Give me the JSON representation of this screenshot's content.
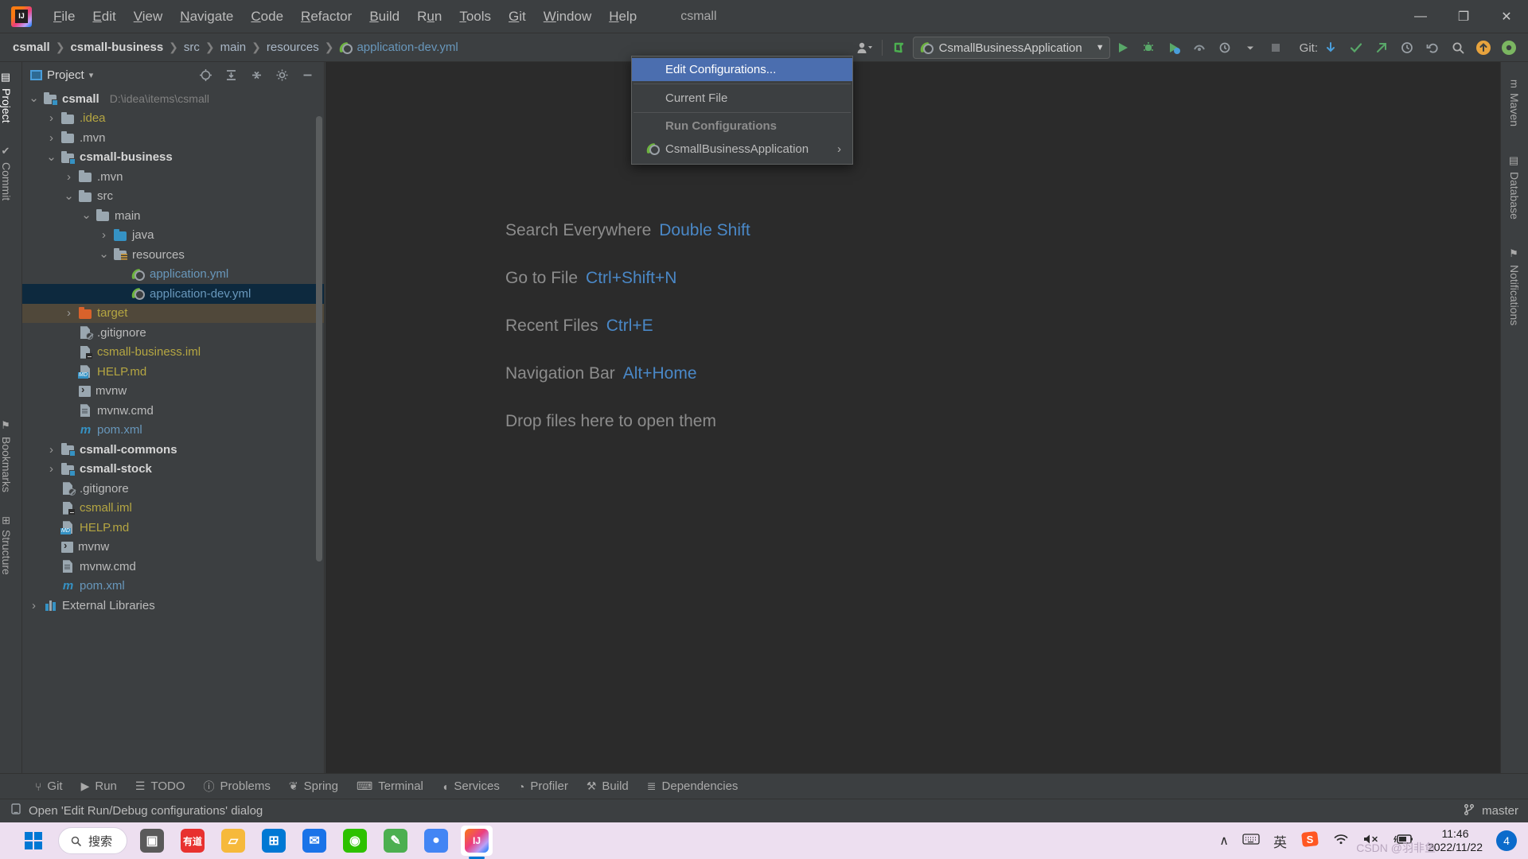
{
  "titlebar": {
    "app_icon": "intellij-idea-logo",
    "project_name": "csmall",
    "menus": [
      {
        "label": "File",
        "mnemonic": "F"
      },
      {
        "label": "Edit",
        "mnemonic": "E"
      },
      {
        "label": "View",
        "mnemonic": "V"
      },
      {
        "label": "Navigate",
        "mnemonic": "N"
      },
      {
        "label": "Code",
        "mnemonic": "C"
      },
      {
        "label": "Refactor",
        "mnemonic": "R"
      },
      {
        "label": "Build",
        "mnemonic": "B"
      },
      {
        "label": "Run",
        "mnemonic": "u"
      },
      {
        "label": "Tools",
        "mnemonic": "T"
      },
      {
        "label": "Git",
        "mnemonic": "G"
      },
      {
        "label": "Window",
        "mnemonic": "W"
      },
      {
        "label": "Help",
        "mnemonic": "H"
      }
    ],
    "window_controls": {
      "minimize": "—",
      "maximize": "❐",
      "close": "✕"
    }
  },
  "navbar": {
    "breadcrumbs": [
      {
        "label": "csmall",
        "style": "bold"
      },
      {
        "label": "csmall-business",
        "style": "bold"
      },
      {
        "label": "src",
        "style": "plain"
      },
      {
        "label": "main",
        "style": "plain"
      },
      {
        "label": "resources",
        "style": "plain"
      },
      {
        "label": "application-dev.yml",
        "style": "file"
      }
    ],
    "separator": "❯"
  },
  "toolbar": {
    "run_config_name": "CsmallBusinessApplication",
    "dropdown_arrow": "▼",
    "git_label": "Git:",
    "icons": [
      {
        "name": "account-icon",
        "glyph": "●"
      },
      {
        "name": "updates-icon",
        "glyph": "↖"
      },
      {
        "name": "run-icon",
        "glyph": "▶"
      },
      {
        "name": "debug-icon",
        "glyph": "✱"
      },
      {
        "name": "run-with-coverage-icon",
        "glyph": "↻"
      },
      {
        "name": "profiler-icon",
        "glyph": "◔"
      },
      {
        "name": "more-run-icon",
        "glyph": "▼"
      },
      {
        "name": "stop-icon",
        "glyph": "■"
      },
      {
        "name": "git-update-icon",
        "glyph": "↙"
      },
      {
        "name": "git-commit-icon",
        "glyph": "✔"
      },
      {
        "name": "git-push-icon",
        "glyph": "↗"
      },
      {
        "name": "git-history-icon",
        "glyph": "◴"
      },
      {
        "name": "git-rollback-icon",
        "glyph": "↶"
      },
      {
        "name": "search-icon",
        "glyph": "⌕"
      },
      {
        "name": "notifications-icon",
        "glyph": "↑"
      },
      {
        "name": "settings-icon",
        "glyph": "⚙"
      }
    ]
  },
  "run_dropdown": {
    "edit_configurations": "Edit Configurations...",
    "current_file": "Current File",
    "section_header": "Run Configurations",
    "configuration": "CsmallBusinessApplication",
    "submenu_arrow": "›"
  },
  "left_tool_strip": [
    {
      "label": "Project",
      "name": "sidebar-item-project"
    },
    {
      "label": "Commit",
      "name": "sidebar-item-commit"
    },
    {
      "label": "Bookmarks",
      "name": "sidebar-item-bookmarks"
    },
    {
      "label": "Structure",
      "name": "sidebar-item-structure"
    }
  ],
  "right_tool_strip": [
    {
      "label": "Maven",
      "name": "sidebar-item-maven"
    },
    {
      "label": "Database",
      "name": "sidebar-item-database"
    },
    {
      "label": "Notifications",
      "name": "sidebar-item-notifications"
    }
  ],
  "project_panel": {
    "title": "Project",
    "dropdown_arrow": "▾",
    "header_icons": [
      {
        "name": "select-opened-file-icon",
        "glyph": "⌖"
      },
      {
        "name": "expand-all-icon",
        "glyph": "⤓"
      },
      {
        "name": "collapse-all-icon",
        "glyph": "⤒"
      },
      {
        "name": "settings-icon",
        "glyph": "⚙"
      },
      {
        "name": "hide-icon",
        "glyph": "—"
      }
    ],
    "tree": [
      {
        "label": "csmall",
        "path": "D:\\idea\\items\\csmall",
        "indent": 0,
        "arrow": "expanded",
        "icon": "module-folder-icon",
        "style": "bold"
      },
      {
        "label": ".idea",
        "indent": 1,
        "arrow": "collapsed",
        "icon": "folder-icon",
        "style": "yellow"
      },
      {
        "label": ".mvn",
        "indent": 1,
        "arrow": "collapsed",
        "icon": "folder-icon",
        "style": "plain"
      },
      {
        "label": "csmall-business",
        "indent": 1,
        "arrow": "expanded",
        "icon": "module-folder-icon",
        "style": "bold"
      },
      {
        "label": ".mvn",
        "indent": 2,
        "arrow": "collapsed",
        "icon": "folder-icon",
        "style": "plain"
      },
      {
        "label": "src",
        "indent": 2,
        "arrow": "expanded",
        "icon": "folder-icon",
        "style": "plain"
      },
      {
        "label": "main",
        "indent": 3,
        "arrow": "expanded",
        "icon": "folder-icon",
        "style": "plain"
      },
      {
        "label": "java",
        "indent": 4,
        "arrow": "collapsed",
        "icon": "sources-root-folder-icon",
        "style": "plain"
      },
      {
        "label": "resources",
        "indent": 4,
        "arrow": "expanded",
        "icon": "resources-root-folder-icon",
        "style": "plain"
      },
      {
        "label": "application.yml",
        "indent": 5,
        "arrow": "none",
        "icon": "spring-yaml-icon",
        "style": "blue"
      },
      {
        "label": "application-dev.yml",
        "indent": 5,
        "arrow": "none",
        "icon": "spring-yaml-icon",
        "style": "blue",
        "selected": true
      },
      {
        "label": "target",
        "indent": 2,
        "arrow": "collapsed",
        "icon": "excluded-folder-icon",
        "style": "yellow",
        "highlight": true
      },
      {
        "label": ".gitignore",
        "indent": 2,
        "arrow": "none",
        "icon": "gitignore-file-icon",
        "style": "plain"
      },
      {
        "label": "csmall-business.iml",
        "indent": 2,
        "arrow": "none",
        "icon": "iml-file-icon",
        "style": "yellow"
      },
      {
        "label": "HELP.md",
        "indent": 2,
        "arrow": "none",
        "icon": "markdown-file-icon",
        "style": "yellow"
      },
      {
        "label": "mvnw",
        "indent": 2,
        "arrow": "none",
        "icon": "shell-script-icon",
        "style": "plain"
      },
      {
        "label": "mvnw.cmd",
        "indent": 2,
        "arrow": "none",
        "icon": "cmd-file-icon",
        "style": "plain"
      },
      {
        "label": "pom.xml",
        "indent": 2,
        "arrow": "none",
        "icon": "maven-pom-icon",
        "style": "blue"
      },
      {
        "label": "csmall-commons",
        "indent": 1,
        "arrow": "collapsed",
        "icon": "module-folder-icon",
        "style": "bold"
      },
      {
        "label": "csmall-stock",
        "indent": 1,
        "arrow": "collapsed",
        "icon": "module-folder-icon",
        "style": "bold"
      },
      {
        "label": ".gitignore",
        "indent": 1,
        "arrow": "none",
        "icon": "gitignore-file-icon",
        "style": "plain"
      },
      {
        "label": "csmall.iml",
        "indent": 1,
        "arrow": "none",
        "icon": "iml-file-icon",
        "style": "yellow"
      },
      {
        "label": "HELP.md",
        "indent": 1,
        "arrow": "none",
        "icon": "markdown-file-icon",
        "style": "yellow"
      },
      {
        "label": "mvnw",
        "indent": 1,
        "arrow": "none",
        "icon": "shell-script-icon",
        "style": "plain"
      },
      {
        "label": "mvnw.cmd",
        "indent": 1,
        "arrow": "none",
        "icon": "cmd-file-icon",
        "style": "plain"
      },
      {
        "label": "pom.xml",
        "indent": 1,
        "arrow": "none",
        "icon": "maven-pom-icon",
        "style": "blue"
      },
      {
        "label": "External Libraries",
        "indent": 0,
        "arrow": "collapsed",
        "icon": "external-libraries-icon",
        "style": "plain"
      }
    ]
  },
  "editor": {
    "hints": [
      {
        "action": "Search Everywhere",
        "shortcut": "Double Shift"
      },
      {
        "action": "Go to File",
        "shortcut": "Ctrl+Shift+N"
      },
      {
        "action": "Recent Files",
        "shortcut": "Ctrl+E"
      },
      {
        "action": "Navigation Bar",
        "shortcut": "Alt+Home"
      },
      {
        "action": "Drop files here to open them",
        "shortcut": ""
      }
    ]
  },
  "bottom_bar": {
    "tabs": [
      {
        "label": "Git",
        "icon": "git-branch-icon",
        "glyph": "⑂"
      },
      {
        "label": "Run",
        "icon": "run-icon",
        "glyph": "▶"
      },
      {
        "label": "TODO",
        "icon": "todo-list-icon",
        "glyph": "☰"
      },
      {
        "label": "Problems",
        "icon": "problems-icon",
        "glyph": "ⓘ"
      },
      {
        "label": "Spring",
        "icon": "spring-leaf-icon",
        "glyph": "❦"
      },
      {
        "label": "Terminal",
        "icon": "terminal-icon",
        "glyph": "⌨"
      },
      {
        "label": "Services",
        "icon": "services-icon",
        "glyph": "◖"
      },
      {
        "label": "Profiler",
        "icon": "profiler-icon",
        "glyph": "◔"
      },
      {
        "label": "Build",
        "icon": "build-hammer-icon",
        "glyph": "⚒"
      },
      {
        "label": "Dependencies",
        "icon": "dependencies-icon",
        "glyph": "≣"
      }
    ]
  },
  "status_bar": {
    "icon": "tooltip-icon",
    "message": "Open 'Edit Run/Debug configurations' dialog",
    "branch_icon": "git-branch-icon",
    "branch": "master"
  },
  "taskbar": {
    "start_label": "start-button",
    "search_placeholder": "搜索",
    "search_icon": "search-icon",
    "apps": [
      {
        "name": "task-view-icon",
        "glyph": "▣",
        "color": "#5a5a5a"
      },
      {
        "name": "youdao-dict-icon",
        "glyph": "有道",
        "color": "#e8312f"
      },
      {
        "name": "file-explorer-icon",
        "glyph": "▱",
        "color": "#f6b93b"
      },
      {
        "name": "microsoft-store-icon",
        "glyph": "⊞",
        "color": "#0078d4"
      },
      {
        "name": "mail-icon",
        "glyph": "✉",
        "color": "#1a73e8"
      },
      {
        "name": "wechat-icon",
        "glyph": "◉",
        "color": "#2dc100"
      },
      {
        "name": "notepad-icon",
        "glyph": "✎",
        "color": "#4caf50"
      },
      {
        "name": "chrome-icon",
        "glyph": "●",
        "color": "#4285f4"
      },
      {
        "name": "intellij-idea-icon",
        "glyph": "IJ",
        "color": "#f97a12"
      }
    ],
    "tray": [
      {
        "name": "show-hidden-icons-icon",
        "glyph": "∧"
      },
      {
        "name": "touch-keyboard-icon",
        "glyph": "⌨"
      },
      {
        "name": "ime-language-icon",
        "glyph": "英"
      },
      {
        "name": "sogou-input-icon",
        "glyph": "S"
      },
      {
        "name": "wifi-icon",
        "glyph": "◠"
      },
      {
        "name": "volume-muted-icon",
        "glyph": "◁✕"
      },
      {
        "name": "battery-charging-icon",
        "glyph": "▭"
      }
    ],
    "clock_time": "11:46",
    "clock_date": "2022/11/22",
    "notification_count": "4",
    "watermark": "CSDN @羽非鱼"
  }
}
